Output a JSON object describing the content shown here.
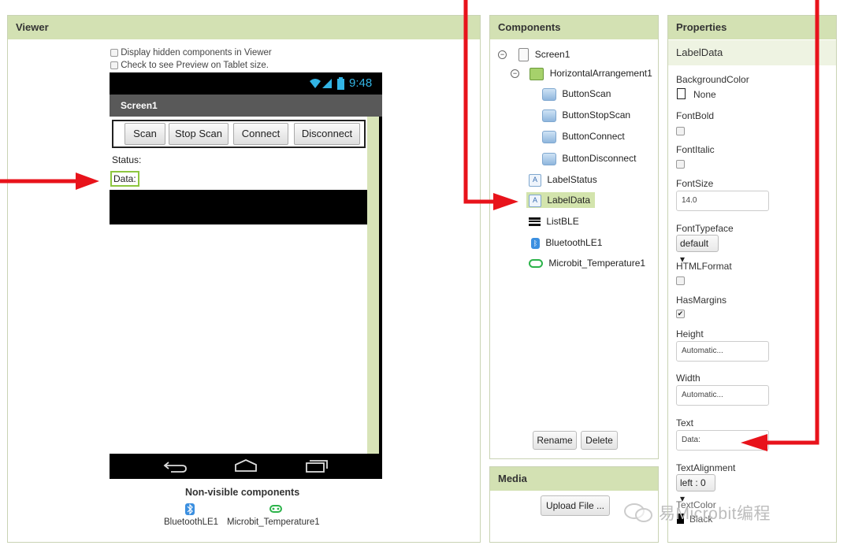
{
  "viewer": {
    "title": "Viewer",
    "display_hidden_label": "Display hidden components in Viewer",
    "tablet_preview_label": "Check to see Preview on Tablet size.",
    "time": "9:48",
    "screen_title": "Screen1",
    "buttons": [
      "Scan",
      "Stop Scan",
      "Connect",
      "Disconnect"
    ],
    "status_label": "Status:",
    "data_label": "Data:",
    "nonvisible_title": "Non-visible components",
    "nonvisible": [
      {
        "label": "BluetoothLE1",
        "icon": "bluetooth-icon"
      },
      {
        "label": "Microbit_Temperature1",
        "icon": "microbit-icon"
      }
    ]
  },
  "components": {
    "title": "Components",
    "tree": [
      {
        "label": "Screen1",
        "icon": "screen-icon"
      },
      {
        "label": "HorizontalArrangement1",
        "icon": "arrangement-icon"
      },
      {
        "label": "ButtonScan",
        "icon": "button-icon"
      },
      {
        "label": "ButtonStopScan",
        "icon": "button-icon"
      },
      {
        "label": "ButtonConnect",
        "icon": "button-icon"
      },
      {
        "label": "ButtonDisconnect",
        "icon": "button-icon"
      },
      {
        "label": "LabelStatus",
        "icon": "label-icon"
      },
      {
        "label": "LabelData",
        "icon": "label-icon"
      },
      {
        "label": "ListBLE",
        "icon": "list-icon"
      },
      {
        "label": "BluetoothLE1",
        "icon": "bluetooth-icon"
      },
      {
        "label": "Microbit_Temperature1",
        "icon": "microbit-icon"
      }
    ],
    "rename_label": "Rename",
    "delete_label": "Delete"
  },
  "media": {
    "title": "Media",
    "upload_label": "Upload File ..."
  },
  "properties": {
    "title": "Properties",
    "component_name": "LabelData",
    "background_color_label": "BackgroundColor",
    "background_color_value": "None",
    "font_bold_label": "FontBold",
    "font_italic_label": "FontItalic",
    "font_size_label": "FontSize",
    "font_size_value": "14.0",
    "font_typeface_label": "FontTypeface",
    "font_typeface_value": "default ▾",
    "html_format_label": "HTMLFormat",
    "has_margins_label": "HasMargins",
    "height_label": "Height",
    "height_value": "Automatic...",
    "width_label": "Width",
    "width_value": "Automatic...",
    "text_label": "Text",
    "text_value": "Data:",
    "text_alignment_label": "TextAlignment",
    "text_alignment_value": "left : 0 ▾",
    "text_color_label": "TextColor",
    "text_color_value": "Black"
  },
  "watermark": "易Microbit编程",
  "colors": {
    "panel_header": "#d3e1b3",
    "phone_title_bar": "#595959",
    "highlight": "#8dc63f",
    "arrow": "#e8131b"
  }
}
